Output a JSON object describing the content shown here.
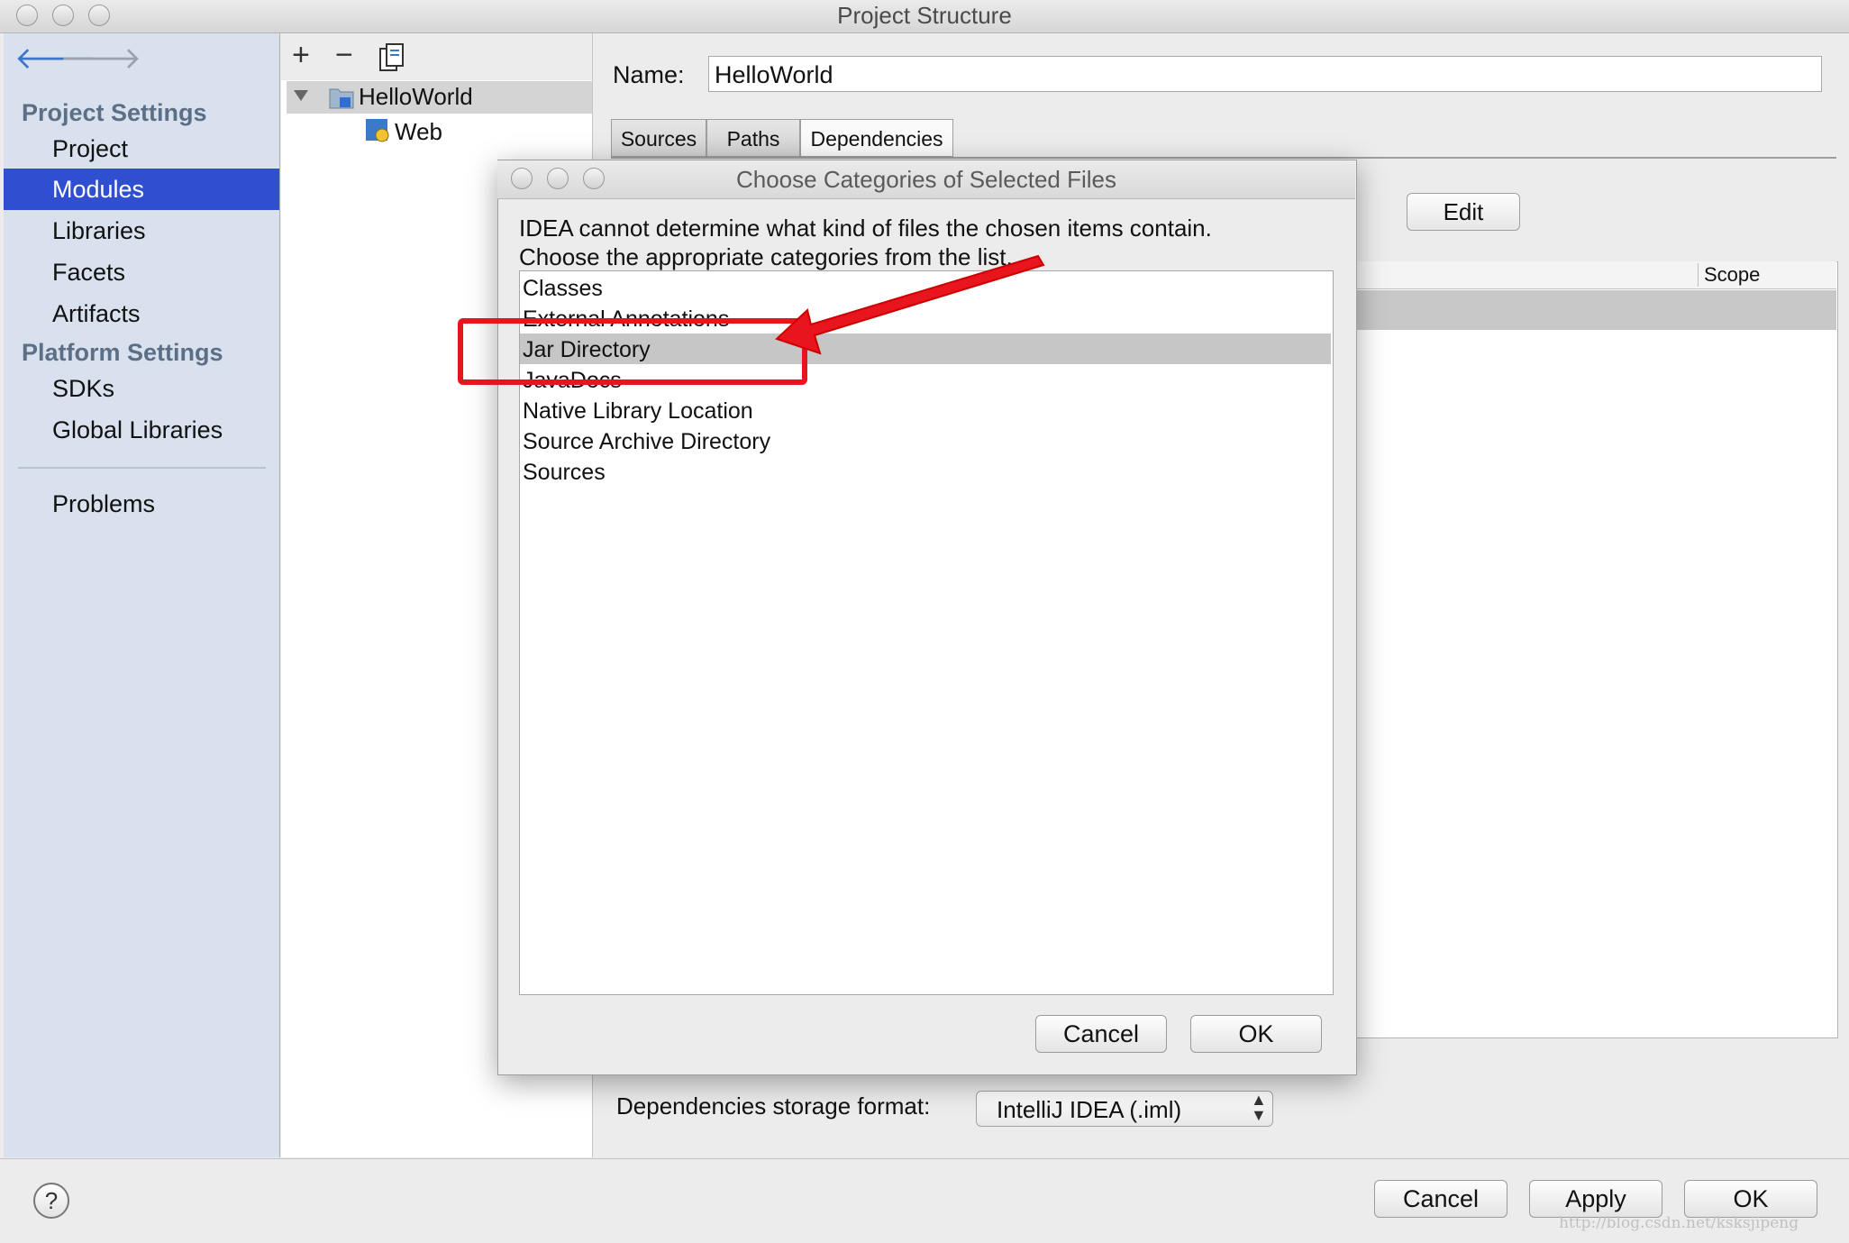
{
  "window": {
    "title": "Project Structure"
  },
  "sidebar": {
    "project_settings_label": "Project Settings",
    "items": [
      {
        "label": "Project"
      },
      {
        "label": "Modules"
      },
      {
        "label": "Libraries"
      },
      {
        "label": "Facets"
      },
      {
        "label": "Artifacts"
      }
    ],
    "platform_settings_label": "Platform Settings",
    "platform_items": [
      {
        "label": "SDKs"
      },
      {
        "label": "Global Libraries"
      }
    ],
    "problems_label": "Problems"
  },
  "tree": {
    "toolbar": {
      "add": "+",
      "remove": "−"
    },
    "root": "HelloWorld",
    "child": "Web"
  },
  "module": {
    "name_label": "Name:",
    "name_value": "HelloWorld",
    "tabs": [
      {
        "label": "Sources"
      },
      {
        "label": "Paths"
      },
      {
        "label": "Dependencies"
      }
    ],
    "edit_label": "Edit",
    "scope_header": "Scope",
    "storage_label": "Dependencies storage format:",
    "storage_value": "IntelliJ IDEA (.iml)"
  },
  "dialog": {
    "title": "Choose Categories of Selected Files",
    "message_line1": "IDEA cannot determine what kind of files the chosen items contain.",
    "message_line2": "Choose the appropriate categories from the list.",
    "items": [
      "Classes",
      "External Annotations",
      "Jar Directory",
      "JavaDocs",
      "Native Library Location",
      "Source Archive Directory",
      "Sources"
    ],
    "selected_index": 2,
    "cancel_label": "Cancel",
    "ok_label": "OK"
  },
  "footer": {
    "help_label": "?",
    "cancel_label": "Cancel",
    "apply_label": "Apply",
    "ok_label": "OK"
  },
  "watermark": "http://blog.csdn.net/ksksjipeng",
  "colors": {
    "selection": "#2f4fd0",
    "annotation": "#e8141e"
  }
}
